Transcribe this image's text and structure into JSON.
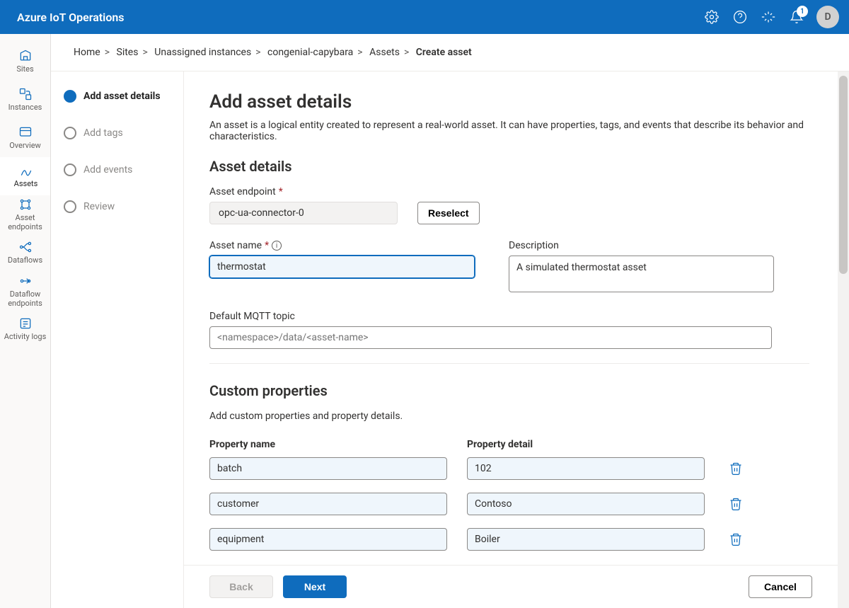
{
  "topbar": {
    "product": "Azure IoT Operations",
    "notification_count": "1",
    "avatar_initial": "D"
  },
  "rail": {
    "items": [
      {
        "id": "sites",
        "label": "Sites"
      },
      {
        "id": "instances",
        "label": "Instances"
      },
      {
        "id": "overview",
        "label": "Overview"
      },
      {
        "id": "assets",
        "label": "Assets"
      },
      {
        "id": "asset-endpoints",
        "label": "Asset endpoints"
      },
      {
        "id": "dataflows",
        "label": "Dataflows"
      },
      {
        "id": "dataflow-endpoints",
        "label": "Dataflow endpoints"
      },
      {
        "id": "activity-logs",
        "label": "Activity logs"
      }
    ],
    "active": "assets"
  },
  "breadcrumbs": [
    "Home",
    "Sites",
    "Unassigned instances",
    "congenial-capybara",
    "Assets",
    "Create asset"
  ],
  "steps": [
    {
      "id": "details",
      "label": "Add asset details",
      "active": true
    },
    {
      "id": "tags",
      "label": "Add tags",
      "active": false
    },
    {
      "id": "events",
      "label": "Add events",
      "active": false
    },
    {
      "id": "review",
      "label": "Review",
      "active": false
    }
  ],
  "form": {
    "title": "Add asset details",
    "lead": "An asset is a logical entity created to represent a real-world asset. It can have properties, tags, and events that describe its behavior and characteristics.",
    "section1_heading": "Asset details",
    "endpoint_label": "Asset endpoint",
    "endpoint_value": "opc-ua-connector-0",
    "reselect_label": "Reselect",
    "name_label": "Asset name",
    "name_value": "thermostat",
    "desc_label": "Description",
    "desc_value": "A simulated thermostat asset",
    "mqtt_label": "Default MQTT topic",
    "mqtt_placeholder": "<namespace>/data/<asset-name>",
    "section2_heading": "Custom properties",
    "section2_lead": "Add custom properties and property details.",
    "col_name": "Property name",
    "col_detail": "Property detail",
    "rows": [
      {
        "name": "batch",
        "detail": "102"
      },
      {
        "name": "customer",
        "detail": "Contoso"
      },
      {
        "name": "equipment",
        "detail": "Boiler"
      }
    ]
  },
  "footer": {
    "back": "Back",
    "next": "Next",
    "cancel": "Cancel"
  }
}
